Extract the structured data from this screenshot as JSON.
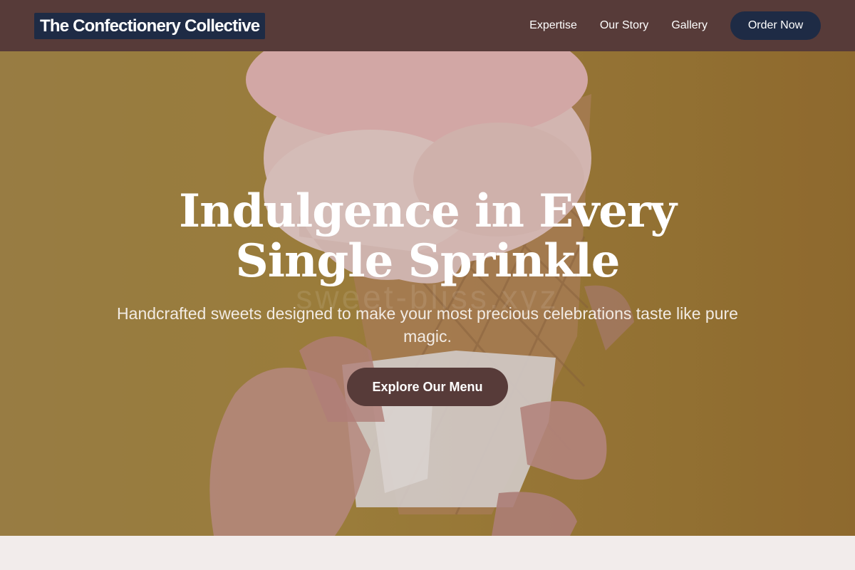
{
  "nav": {
    "brand": "The Confectionery Collective",
    "links": [
      "Expertise",
      "Our Story",
      "Gallery"
    ],
    "cta": "Order Now"
  },
  "hero": {
    "title_line1": "Indulgence in Every",
    "title_line2": "Single Sprinkle",
    "watermark": "sweet-bliss.xyz",
    "subtitle": "Handcrafted sweets designed to make your most precious celebrations taste like pure magic.",
    "cta": "Explore Our Menu"
  },
  "colors": {
    "nav_bg": "#573b39",
    "brand_bg": "#1e2b45",
    "cta_bg": "#573b39",
    "hero_bg": "#a8883e",
    "page_bg": "#f2eceb"
  }
}
